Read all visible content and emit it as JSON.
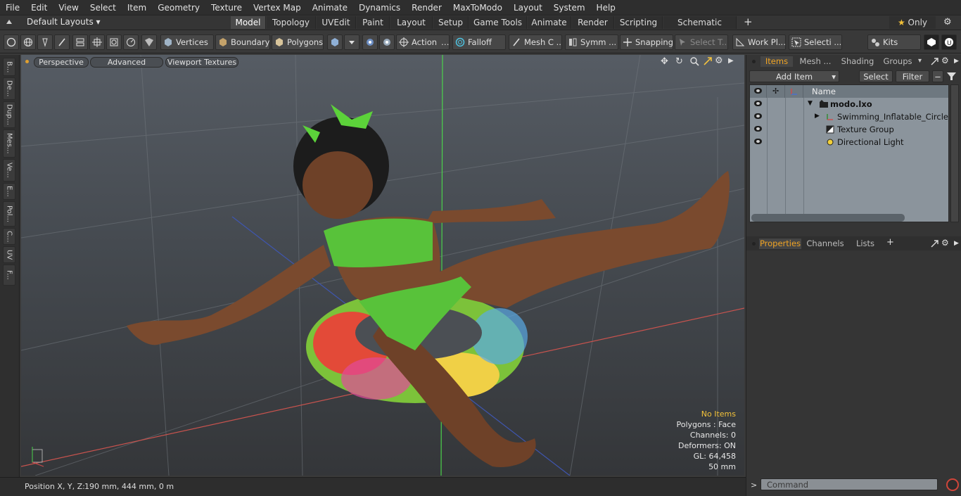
{
  "menu": [
    "File",
    "Edit",
    "View",
    "Select",
    "Item",
    "Geometry",
    "Texture",
    "Vertex Map",
    "Animate",
    "Dynamics",
    "Render",
    "MaxToModo",
    "Layout",
    "System",
    "Help"
  ],
  "layout_selector": "Default Layouts",
  "tabs": [
    "Model",
    "Topology",
    "UVEdit",
    "Paint",
    "Layout",
    "Setup",
    "Game Tools",
    "Animate",
    "Render",
    "Scripting",
    "Schematic Fusion"
  ],
  "only_label": "Only",
  "toolbar": {
    "vertices": "Vertices",
    "boundary": "Boundary",
    "polygons": "Polygons",
    "action": "Action",
    "falloff": "Falloff",
    "meshc": "Mesh C ...",
    "symm": "Symm ...",
    "snapping": "Snapping",
    "selectt": "Select T...",
    "workpl": "Work Pl...",
    "selecti": "Selecti ...",
    "kits": "Kits"
  },
  "left_tabs": [
    "B...",
    "De...",
    "Dup...",
    "Mes...",
    "Ve...",
    "E...",
    "Pol...",
    "C...",
    "UV",
    "F..."
  ],
  "viewport": {
    "perspective": "Perspective",
    "advanced": "Advanced",
    "textures": "Viewport Textures",
    "hud": {
      "no_items": "No Items",
      "polygons": "Polygons : Face",
      "channels": "Channels: 0",
      "deformers": "Deformers: ON",
      "gl": "GL: 64,458",
      "scale": "50 mm"
    }
  },
  "status": {
    "label": "Position X, Y, Z:",
    "value": "190 mm, 444 mm, 0 m"
  },
  "items_panel": {
    "tabs": [
      "Items",
      "Mesh ...",
      "Shading",
      "Groups"
    ],
    "add_item": "Add Item",
    "select": "Select",
    "filter": "Filter",
    "name_col": "Name",
    "items": [
      "modo.lxo",
      "Swimming_Inflatable_Circle_B...",
      "Texture Group",
      "Directional Light"
    ]
  },
  "props_panel": {
    "tabs": [
      "Properties",
      "Channels",
      "Lists"
    ]
  },
  "command": {
    "placeholder": "Command"
  }
}
